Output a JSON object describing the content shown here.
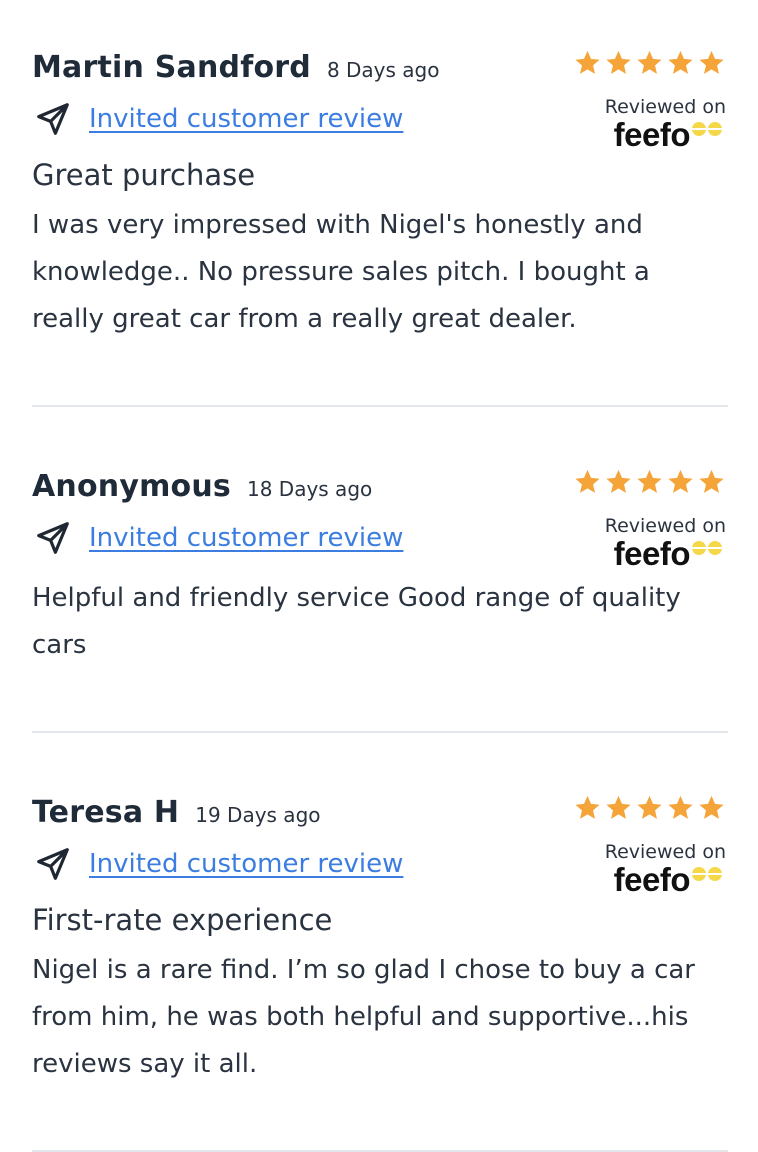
{
  "reviews": [
    {
      "name": "Martin Sandford",
      "ago": "8 Days ago",
      "invite_label": "Invited customer review",
      "rating": 5,
      "reviewed_on": "Reviewed on",
      "brand": "feefo",
      "title": "Great purchase",
      "body": "I was very impressed with Nigel's honestly and knowledge.. No pressure sales pitch. I bought a really great car from a really great dealer."
    },
    {
      "name": "Anonymous",
      "ago": "18 Days ago",
      "invite_label": "Invited customer review",
      "rating": 5,
      "reviewed_on": "Reviewed on",
      "brand": "feefo",
      "title": "",
      "body": "Helpful and friendly service Good range of quality cars"
    },
    {
      "name": "Teresa H",
      "ago": "19 Days ago",
      "invite_label": "Invited customer review",
      "rating": 5,
      "reviewed_on": "Reviewed on",
      "brand": "feefo",
      "title": "First-rate experience",
      "body": "Nigel is a rare find. I’m so glad I chose to buy a car from him, he was both helpful and supportive...his reviews say it all."
    }
  ],
  "colors": {
    "star": "#f4a438",
    "link": "#3b7de0",
    "text": "#2a3340",
    "feefo_eyes": "#f5d84a"
  },
  "icons": {
    "invite": "paper-plane-icon",
    "star": "star-icon"
  }
}
